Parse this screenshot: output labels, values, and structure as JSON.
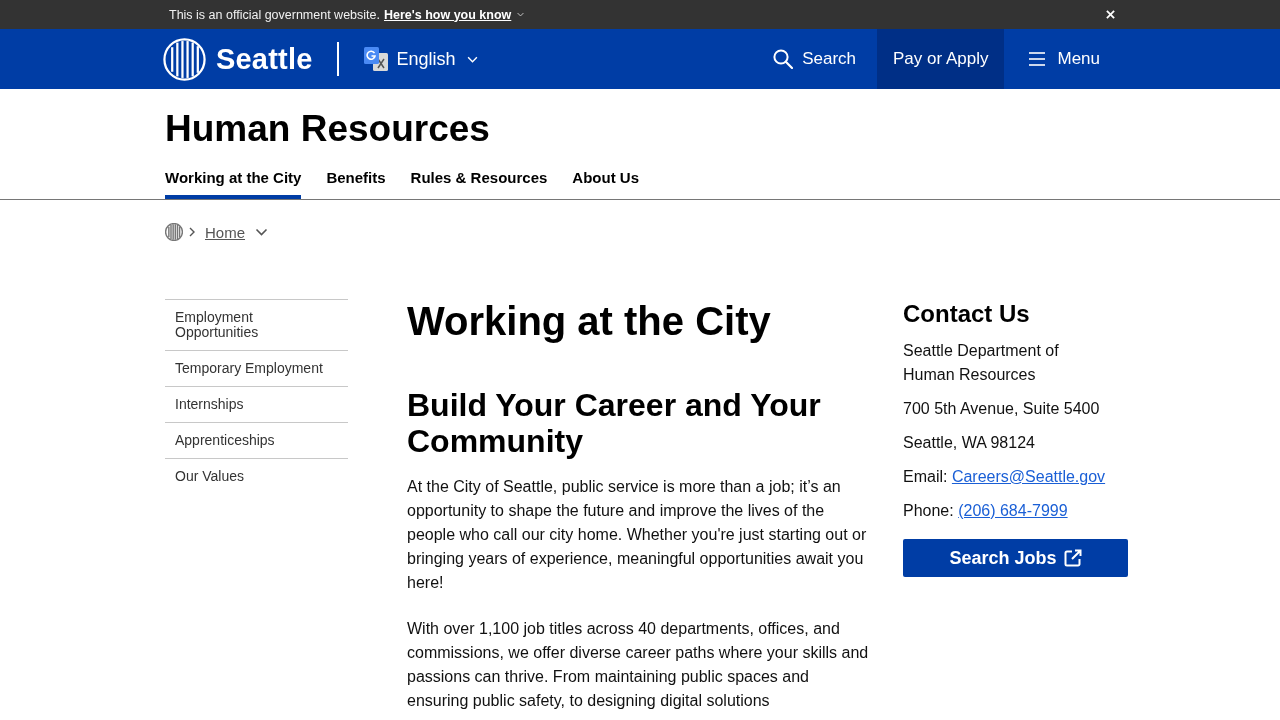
{
  "gov_banner": {
    "text": "This is an official government website.",
    "link": "Here's how you know"
  },
  "header": {
    "logo": "Seattle",
    "language": "English",
    "nav_buttons": [
      {
        "kind": "search",
        "label": "Search"
      },
      {
        "kind": "highlight",
        "label": "Pay or Apply"
      },
      {
        "kind": "menu",
        "label": "Menu"
      }
    ]
  },
  "site_title": "Human Resources",
  "tabs": [
    {
      "label": "Working at the City",
      "selected": true
    },
    {
      "label": "Benefits",
      "selected": false
    },
    {
      "label": "Rules & Resources",
      "selected": false
    },
    {
      "label": "About Us",
      "selected": false
    }
  ],
  "breadcrumb": {
    "items": [
      "Home"
    ]
  },
  "sidebar": {
    "items": [
      "Employment Opportunities",
      "Temporary Employment",
      "Internships",
      "Apprenticeships",
      "Our Values"
    ]
  },
  "main": {
    "title": "Working at the City",
    "sections": [
      {
        "heading": "Build Your Career and Your Community",
        "paragraphs": [
          "At the City of Seattle, public service is more than a job; it’s an opportunity to shape the future and improve the lives of the people who call our city home. Whether you're just starting out or bringing years of experience, meaningful opportunities await you here!",
          "With over 1,100 job titles across 40 departments, offices, and commissions, we offer diverse career paths where your skills and passions can thrive. From maintaining public spaces and ensuring public safety, to designing digital solutions"
        ]
      }
    ]
  },
  "contact": {
    "heading": "Contact Us",
    "items": [
      {
        "kind": "text",
        "text": "Seattle Department of Human Resources"
      },
      {
        "kind": "text",
        "text": "700 5th Avenue, Suite 5400"
      },
      {
        "kind": "text",
        "text": "Seattle, WA 98124"
      },
      {
        "kind": "link",
        "label": "Email:",
        "link": "Careers@Seattle.gov"
      },
      {
        "kind": "link",
        "label": "Phone:",
        "link": "(206) 684-7999"
      }
    ],
    "button": "Search Jobs"
  }
}
